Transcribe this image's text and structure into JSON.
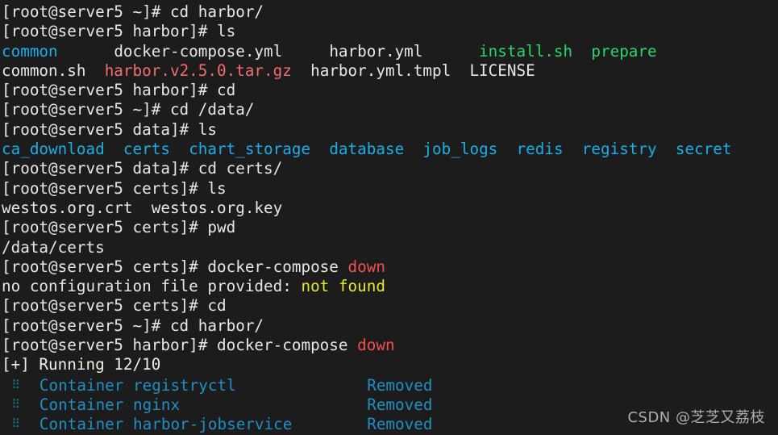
{
  "terminal": {
    "background_color": "#1c1c1c",
    "foreground_color": "#e8e8e3",
    "colors": {
      "directory": "#1aaee8",
      "archive": "#f26d6d",
      "executable": "#29d767",
      "error_red": "#f2514e",
      "warning_yellow": "#e8e82e",
      "status_cyan": "#1f8fc4",
      "bullet_dot": "#1a6e8e"
    },
    "host": "server5",
    "user": "root",
    "lines": [
      {
        "id": "l1",
        "segments": [
          {
            "text": "[root@server5 ~]# cd harbor/",
            "color": "default"
          }
        ]
      },
      {
        "id": "l2",
        "segments": [
          {
            "text": "[root@server5 harbor]# ls",
            "color": "default"
          }
        ]
      },
      {
        "id": "l3",
        "segments": [
          {
            "text": "common",
            "color": "dir"
          },
          {
            "text": "      ",
            "color": "default"
          },
          {
            "text": "docker-compose.yml",
            "color": "default"
          },
          {
            "text": "     ",
            "color": "default"
          },
          {
            "text": "harbor.yml",
            "color": "default"
          },
          {
            "text": "      ",
            "color": "default"
          },
          {
            "text": "install.sh",
            "color": "exec"
          },
          {
            "text": "  ",
            "color": "default"
          },
          {
            "text": "prepare",
            "color": "exec"
          }
        ]
      },
      {
        "id": "l4",
        "segments": [
          {
            "text": "common.sh",
            "color": "default"
          },
          {
            "text": "  ",
            "color": "default"
          },
          {
            "text": "harbor.v2.5.0.tar.gz",
            "color": "archive"
          },
          {
            "text": "  ",
            "color": "default"
          },
          {
            "text": "harbor.yml.tmpl",
            "color": "default"
          },
          {
            "text": "  ",
            "color": "default"
          },
          {
            "text": "LICENSE",
            "color": "default"
          }
        ]
      },
      {
        "id": "l5",
        "segments": [
          {
            "text": "[root@server5 harbor]# cd",
            "color": "default"
          }
        ]
      },
      {
        "id": "l6",
        "segments": [
          {
            "text": "[root@server5 ~]# cd /data/",
            "color": "default"
          }
        ]
      },
      {
        "id": "l7",
        "segments": [
          {
            "text": "[root@server5 data]# ls",
            "color": "default"
          }
        ]
      },
      {
        "id": "l8",
        "segments": [
          {
            "text": "ca_download",
            "color": "dir"
          },
          {
            "text": "  ",
            "color": "default"
          },
          {
            "text": "certs",
            "color": "dir"
          },
          {
            "text": "  ",
            "color": "default"
          },
          {
            "text": "chart_storage",
            "color": "dir"
          },
          {
            "text": "  ",
            "color": "default"
          },
          {
            "text": "database",
            "color": "dir"
          },
          {
            "text": "  ",
            "color": "default"
          },
          {
            "text": "job_logs",
            "color": "dir"
          },
          {
            "text": "  ",
            "color": "default"
          },
          {
            "text": "redis",
            "color": "dir"
          },
          {
            "text": "  ",
            "color": "default"
          },
          {
            "text": "registry",
            "color": "dir"
          },
          {
            "text": "  ",
            "color": "default"
          },
          {
            "text": "secret",
            "color": "dir"
          }
        ]
      },
      {
        "id": "l9",
        "segments": [
          {
            "text": "[root@server5 data]# cd certs/",
            "color": "default"
          }
        ]
      },
      {
        "id": "l10",
        "segments": [
          {
            "text": "[root@server5 certs]# ls",
            "color": "default"
          }
        ]
      },
      {
        "id": "l11",
        "segments": [
          {
            "text": "westos.org.crt  westos.org.key",
            "color": "default"
          }
        ]
      },
      {
        "id": "l12",
        "segments": [
          {
            "text": "[root@server5 certs]# pwd",
            "color": "default"
          }
        ]
      },
      {
        "id": "l13",
        "segments": [
          {
            "text": "/data/certs",
            "color": "default"
          }
        ]
      },
      {
        "id": "l14",
        "segments": [
          {
            "text": "[root@server5 certs]# docker-compose ",
            "color": "default"
          },
          {
            "text": "down",
            "color": "red"
          }
        ]
      },
      {
        "id": "l15",
        "segments": [
          {
            "text": "no configuration file provided: ",
            "color": "default"
          },
          {
            "text": "not found",
            "color": "yellow"
          }
        ]
      },
      {
        "id": "l16",
        "segments": [
          {
            "text": "[root@server5 certs]# cd",
            "color": "default"
          }
        ]
      },
      {
        "id": "l17",
        "segments": [
          {
            "text": "[root@server5 ~]# cd harbor/",
            "color": "default"
          }
        ]
      },
      {
        "id": "l18",
        "segments": [
          {
            "text": "[root@server5 harbor]# docker-compose ",
            "color": "default"
          },
          {
            "text": "down",
            "color": "red"
          }
        ]
      },
      {
        "id": "l19",
        "segments": [
          {
            "text": "[+] Running 12/10",
            "color": "cream"
          }
        ]
      },
      {
        "id": "l20",
        "bullet": true,
        "segments": [
          {
            "text": "Container registryctl              ",
            "color": "cyan"
          },
          {
            "text": "Removed",
            "color": "cyan"
          }
        ]
      },
      {
        "id": "l21",
        "bullet": true,
        "segments": [
          {
            "text": "Container nginx                    ",
            "color": "cyan"
          },
          {
            "text": "Removed",
            "color": "cyan"
          }
        ]
      },
      {
        "id": "l22",
        "bullet": true,
        "segments": [
          {
            "text": "Container harbor-jobservice        ",
            "color": "cyan"
          },
          {
            "text": "Removed",
            "color": "cyan"
          }
        ]
      }
    ]
  },
  "watermark": {
    "text": "CSDN @芝芝又荔枝"
  },
  "icons": {
    "bullet_dot_glyph": "⠿",
    "bullet_icon_name": "braille-dots-icon"
  }
}
